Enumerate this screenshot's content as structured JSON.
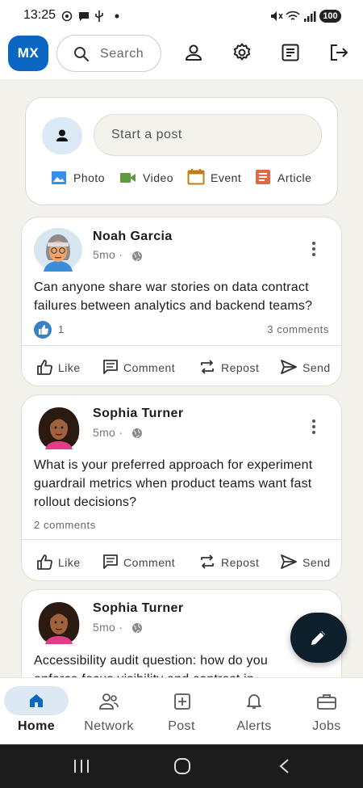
{
  "status_bar": {
    "time": "13:25",
    "battery": "100"
  },
  "header": {
    "avatar_initials": "MX",
    "search_placeholder": "Search",
    "icons": [
      "person-icon",
      "gear-icon",
      "notes-icon",
      "logout-icon"
    ]
  },
  "composer": {
    "placeholder": "Start a post",
    "actions": [
      {
        "label": "Photo",
        "icon": "photo-icon",
        "color": "#378fe9"
      },
      {
        "label": "Video",
        "icon": "video-icon",
        "color": "#5f9b41"
      },
      {
        "label": "Event",
        "icon": "calendar-icon",
        "color": "#c37d16"
      },
      {
        "label": "Article",
        "icon": "article-icon",
        "color": "#e06847"
      }
    ]
  },
  "posts": [
    {
      "author": "Noah Garcia",
      "time": "5mo",
      "text": "Can anyone share war stories on data contract failures between analytics and backend teams?",
      "likes": "1",
      "comments": "3 comments"
    },
    {
      "author": "Sophia Turner",
      "time": "5mo",
      "text": "What is your preferred approach for experiment guardrail metrics when product teams want fast rollout decisions?",
      "comments": "2 comments"
    },
    {
      "author": "Sophia Turner",
      "time": "5mo",
      "text": "Accessibility audit question: how do you enforce focus visibility and contrast in"
    }
  ],
  "post_actions": {
    "like": "Like",
    "comment": "Comment",
    "repost": "Repost",
    "send": "Send"
  },
  "bottom_nav": [
    {
      "label": "Home",
      "icon": "home-icon",
      "active": true
    },
    {
      "label": "Network",
      "icon": "network-icon"
    },
    {
      "label": "Post",
      "icon": "add-post-icon"
    },
    {
      "label": "Alerts",
      "icon": "bell-icon"
    },
    {
      "label": "Jobs",
      "icon": "briefcase-icon"
    }
  ],
  "colors": {
    "brand": "#0a66c2",
    "feed_bg": "#f3f1ec",
    "fab": "#0e1f2c"
  }
}
